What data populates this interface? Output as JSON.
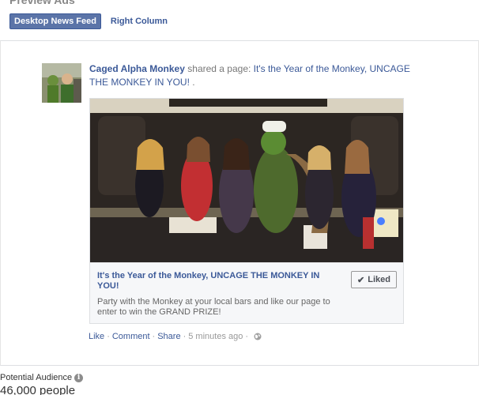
{
  "header": {
    "section_title": "Preview Ads",
    "tabs": [
      {
        "label": "Desktop News Feed",
        "active": true
      },
      {
        "label": "Right Column",
        "active": false
      }
    ]
  },
  "post": {
    "author": "Caged Alpha Monkey",
    "shared_verb": "shared a page:",
    "page_link": "It's the Year of the Monkey, UNCAGE THE MONKEY IN YOU!",
    "trailing": " .",
    "card": {
      "title": "It's the Year of the Monkey, UNCAGE THE MONKEY IN YOU!",
      "description": "Party with the Monkey at your local bars and like our page to enter to win the GRAND PRIZE!",
      "liked_label": "Liked",
      "check_icon": "check-icon"
    },
    "actions": {
      "like": "Like",
      "comment": "Comment",
      "share": "Share",
      "separator": "·",
      "timestamp": "5 minutes ago",
      "privacy_icon": "globe-icon"
    }
  },
  "audience": {
    "label": "Potential Audience",
    "info_icon": "info-icon",
    "count": "46,000 people"
  },
  "colors": {
    "brand_blue": "#3b5998",
    "tab_active_bg": "#5b74a8",
    "card_bg": "#f6f7f9"
  }
}
